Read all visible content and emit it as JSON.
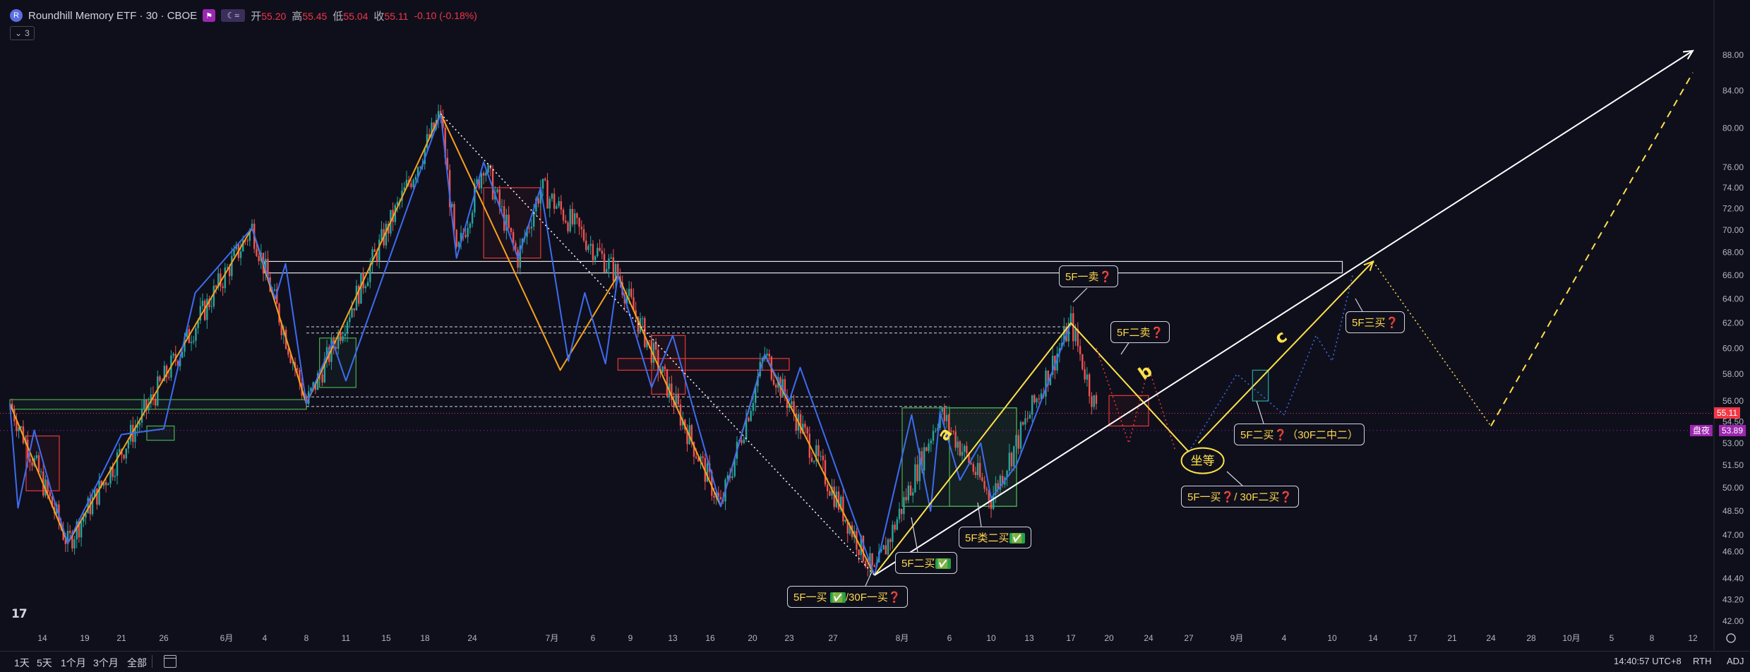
{
  "header": {
    "symbol_title": "Roundhill Memory ETF · 30 · CBOE",
    "logo_letter": "R",
    "open_label": "开",
    "open": "55.20",
    "high_label": "高",
    "high": "55.45",
    "low_label": "低",
    "low": "55.04",
    "close_label": "收",
    "close": "55.11",
    "change": "-0.10 (-0.18%)",
    "indicator_count": "3"
  },
  "bottom_bar": {
    "ranges": [
      "1天",
      "5天",
      "1个月",
      "3个月",
      "全部"
    ],
    "clock": "14:40:57 UTC+8",
    "rth": "RTH",
    "adj": "ADJ"
  },
  "price_tags": {
    "last": "55.11",
    "extended_label": "盘夜",
    "extended": "53.89",
    "last_color": "#f23645",
    "extended_color": "#9c27b0"
  },
  "colors": {
    "background": "#0f0f1c",
    "orange_stroke": "#f7a21b",
    "blue_stroke": "#3d6cf0",
    "yellow": "#ffe24a",
    "bull": "#26a69a",
    "bear": "#ef5350"
  },
  "annotations": {
    "c1": {
      "text": "5F一买",
      "ok": "✅",
      "text2": "/30F一买",
      "q": "❓"
    },
    "c2": {
      "text": "5F二买",
      "ok": "✅"
    },
    "c3": {
      "text": "5F类二买",
      "ok": "✅"
    },
    "c4": {
      "text": "5F一卖",
      "q": "❓"
    },
    "c5": {
      "text": "5F二卖",
      "q": "❓"
    },
    "c6": {
      "text": "5F三买",
      "q": "❓"
    },
    "c7": {
      "text": "5F二买",
      "q": "❓",
      "text2": "（30F二中二）"
    },
    "c8": {
      "text": "5F一买",
      "q": "❓",
      "text2": "/ 30F二买",
      "q2": "❓"
    },
    "circle": "坐等",
    "letter_a": "a",
    "letter_b": "b",
    "letter_c": "c"
  },
  "chart_data": {
    "type": "line",
    "title": "Roundhill Memory ETF · 30 · CBOE",
    "y_axis": {
      "scale": "log",
      "ticks": [
        42.0,
        43.2,
        44.4,
        46.0,
        47.0,
        48.5,
        50.0,
        51.5,
        53.0,
        54.5,
        56.0,
        58.0,
        60.0,
        62.0,
        64.0,
        66.0,
        68.0,
        70.0,
        72.0,
        74.0,
        76.0,
        80.0,
        84.0,
        88.0
      ],
      "range": [
        41.5,
        89.5
      ]
    },
    "x_axis": {
      "ticks": [
        {
          "date": "2025-05-14",
          "label": "14"
        },
        {
          "date": "2025-05-19",
          "label": "19"
        },
        {
          "date": "2025-05-21",
          "label": "21"
        },
        {
          "date": "2025-05-26",
          "label": "26"
        },
        {
          "date": "2025-06-01",
          "label": "6月"
        },
        {
          "date": "2025-06-04",
          "label": "4"
        },
        {
          "date": "2025-06-08",
          "label": "8"
        },
        {
          "date": "2025-06-11",
          "label": "11"
        },
        {
          "date": "2025-06-15",
          "label": "15"
        },
        {
          "date": "2025-06-18",
          "label": "18"
        },
        {
          "date": "2025-06-24",
          "label": "24"
        },
        {
          "date": "2025-07-01",
          "label": "7月"
        },
        {
          "date": "2025-07-06",
          "label": "6"
        },
        {
          "date": "2025-07-09",
          "label": "9"
        },
        {
          "date": "2025-07-13",
          "label": "13"
        },
        {
          "date": "2025-07-16",
          "label": "16"
        },
        {
          "date": "2025-07-20",
          "label": "20"
        },
        {
          "date": "2025-07-23",
          "label": "23"
        },
        {
          "date": "2025-07-27",
          "label": "27"
        },
        {
          "date": "2025-08-01",
          "label": "8月"
        },
        {
          "date": "2025-08-06",
          "label": "6"
        },
        {
          "date": "2025-08-10",
          "label": "10"
        },
        {
          "date": "2025-08-13",
          "label": "13"
        },
        {
          "date": "2025-08-17",
          "label": "17"
        },
        {
          "date": "2025-08-20",
          "label": "20"
        },
        {
          "date": "2025-08-24",
          "label": "24"
        },
        {
          "date": "2025-08-27",
          "label": "27"
        },
        {
          "date": "2025-09-01",
          "label": "9月"
        },
        {
          "date": "2025-09-04",
          "label": "4"
        },
        {
          "date": "2025-09-10",
          "label": "10"
        },
        {
          "date": "2025-09-14",
          "label": "14"
        },
        {
          "date": "2025-09-17",
          "label": "17"
        },
        {
          "date": "2025-09-21",
          "label": "21"
        },
        {
          "date": "2025-09-24",
          "label": "24"
        },
        {
          "date": "2025-09-28",
          "label": "28"
        },
        {
          "date": "2025-10-01",
          "label": "10月"
        },
        {
          "date": "2025-10-05",
          "label": "5"
        },
        {
          "date": "2025-10-08",
          "label": "8"
        },
        {
          "date": "2025-10-12",
          "label": "12"
        }
      ]
    },
    "series": [
      {
        "role": "orange-stroke-lines",
        "points": [
          [
            "2025-05-10",
            55.8
          ],
          [
            "2025-05-17",
            46.5
          ],
          [
            "2025-06-03",
            70.2
          ],
          [
            "2025-06-08",
            55.8
          ],
          [
            "2025-06-20",
            81.5
          ],
          [
            "2025-07-02",
            58.3
          ],
          [
            "2025-07-08",
            66.0
          ],
          [
            "2025-07-17",
            48.8
          ],
          [
            "2025-07-21",
            59.5
          ],
          [
            "2025-07-30",
            44.6
          ]
        ]
      },
      {
        "role": "blue-stroke-lines",
        "points": [
          [
            "2025-05-10",
            55.8
          ],
          [
            "2025-05-11",
            48.7
          ],
          [
            "2025-05-13",
            53.9
          ],
          [
            "2025-05-15",
            49.9
          ],
          [
            "2025-05-17",
            46.5
          ],
          [
            "2025-05-21",
            53.6
          ],
          [
            "2025-05-26",
            54.0
          ],
          [
            "2025-05-29",
            64.5
          ],
          [
            "2025-06-03",
            70.2
          ],
          [
            "2025-06-05",
            64.0
          ],
          [
            "2025-06-06",
            67.0
          ],
          [
            "2025-06-08",
            55.8
          ],
          [
            "2025-06-10",
            60.5
          ],
          [
            "2025-06-11",
            57.5
          ],
          [
            "2025-06-20",
            81.5
          ],
          [
            "2025-06-22",
            67.5
          ],
          [
            "2025-06-25",
            76.5
          ],
          [
            "2025-06-28",
            67.5
          ],
          [
            "2025-06-30",
            74.0
          ],
          [
            "2025-07-03",
            59.0
          ],
          [
            "2025-07-05",
            64.5
          ],
          [
            "2025-07-07",
            58.8
          ],
          [
            "2025-07-08",
            66.0
          ],
          [
            "2025-07-11",
            57.0
          ],
          [
            "2025-07-13",
            61.0
          ],
          [
            "2025-07-17",
            48.8
          ],
          [
            "2025-07-21",
            59.5
          ],
          [
            "2025-07-23",
            56.0
          ],
          [
            "2025-07-24",
            58.5
          ],
          [
            "2025-07-30",
            44.6
          ],
          [
            "2025-08-02",
            55.0
          ],
          [
            "2025-08-04",
            48.5
          ],
          [
            "2025-08-05",
            55.2
          ],
          [
            "2025-08-07",
            50.5
          ],
          [
            "2025-08-09",
            53.0
          ],
          [
            "2025-08-10",
            49.3
          ],
          [
            "2025-08-12",
            51.5
          ],
          [
            "2025-08-17",
            62.0
          ]
        ]
      },
      {
        "role": "yellow-stroke-lines",
        "points": [
          [
            "2025-07-30",
            44.6
          ],
          [
            "2025-08-17",
            62.0
          ],
          [
            "2025-08-27",
            52.4
          ]
        ]
      },
      {
        "role": "yellow-projection",
        "points": [
          [
            "2025-08-28",
            53.0
          ],
          [
            "2025-09-14",
            67.2
          ]
        ]
      },
      {
        "role": "yellow-dotted-projection",
        "points": [
          [
            "2025-09-14",
            67.2
          ],
          [
            "2025-09-24",
            54.2
          ]
        ]
      },
      {
        "role": "yellow-dashed-projection",
        "points": [
          [
            "2025-09-24",
            54.2
          ],
          [
            "2025-10-12",
            86.0
          ]
        ]
      },
      {
        "role": "white-trendline-arrow",
        "points": [
          [
            "2025-07-30",
            44.6
          ],
          [
            "2025-10-12",
            88.5
          ]
        ]
      },
      {
        "role": "white-dotted-trendline",
        "points": [
          [
            "2025-06-20",
            81.5
          ],
          [
            "2025-07-30",
            44.6
          ]
        ]
      },
      {
        "role": "blue-dotted-projection",
        "points": [
          [
            "2025-08-27",
            52.4
          ],
          [
            "2025-09-01",
            58.0
          ],
          [
            "2025-09-04",
            55.0
          ],
          [
            "2025-09-08",
            61.0
          ],
          [
            "2025-09-10",
            59.0
          ],
          [
            "2025-09-12",
            66.0
          ]
        ]
      },
      {
        "role": "red-dotted-projection",
        "points": [
          [
            "2025-08-19",
            60.0
          ],
          [
            "2025-08-22",
            53.0
          ],
          [
            "2025-08-24",
            58.5
          ],
          [
            "2025-08-26",
            52.5
          ]
        ]
      }
    ],
    "candles": {
      "path": [
        [
          "2025-05-10",
          55.8
        ],
        [
          "2025-05-17",
          46.5
        ],
        [
          "2025-06-03",
          70.2
        ],
        [
          "2025-06-08",
          55.8
        ],
        [
          "2025-06-20",
          81.5
        ],
        [
          "2025-06-22",
          67.5
        ],
        [
          "2025-06-25",
          76.5
        ],
        [
          "2025-06-28",
          67.5
        ],
        [
          "2025-06-30",
          74.0
        ],
        [
          "2025-07-08",
          66.0
        ],
        [
          "2025-07-17",
          48.8
        ],
        [
          "2025-07-21",
          59.5
        ],
        [
          "2025-07-30",
          44.6
        ],
        [
          "2025-08-05",
          55.2
        ],
        [
          "2025-08-10",
          49.3
        ],
        [
          "2025-08-17",
          62.0
        ],
        [
          "2025-08-19",
          55.3
        ]
      ]
    },
    "zones": [
      {
        "color": "white",
        "x": [
          "2025-06-04",
          "2025-09-11"
        ],
        "y": [
          66.2,
          67.2
        ]
      },
      {
        "color": "green",
        "x": [
          "2025-05-10",
          "2025-06-08"
        ],
        "y": [
          55.4,
          56.1
        ]
      },
      {
        "color": "red",
        "x": [
          "2025-05-12",
          "2025-05-16"
        ],
        "y": [
          49.8,
          53.5
        ]
      },
      {
        "color": "green",
        "x": [
          "2025-05-24",
          "2025-05-27"
        ],
        "y": [
          53.2,
          54.2
        ]
      },
      {
        "color": "green",
        "x": [
          "2025-06-09",
          "2025-06-12"
        ],
        "y": [
          57.0,
          60.8
        ]
      },
      {
        "color": "red",
        "x": [
          "2025-06-25",
          "2025-06-30"
        ],
        "y": [
          67.5,
          74.0
        ]
      },
      {
        "color": "red",
        "x": [
          "2025-07-08",
          "2025-07-23"
        ],
        "y": [
          58.3,
          59.2
        ]
      },
      {
        "color": "red",
        "x": [
          "2025-07-11",
          "2025-07-14"
        ],
        "y": [
          56.5,
          61.0
        ]
      },
      {
        "color": "green",
        "x": [
          "2025-08-01",
          "2025-08-12"
        ],
        "y": [
          48.8,
          55.5
        ]
      },
      {
        "color": "green",
        "x": [
          "2025-08-06",
          "2025-08-12"
        ],
        "y": [
          48.8,
          55.5
        ]
      },
      {
        "color": "red",
        "x": [
          "2025-08-20",
          "2025-08-24"
        ],
        "y": [
          54.2,
          56.4
        ]
      },
      {
        "color": "cyan",
        "x": [
          "2025-09-02",
          "2025-09-03"
        ],
        "y": [
          56.0,
          58.3
        ]
      }
    ],
    "horizontal_dashed": [
      {
        "y": 61.7,
        "x": [
          "2025-06-08",
          "2025-08-17"
        ]
      },
      {
        "y": 61.2,
        "x": [
          "2025-06-08",
          "2025-08-17"
        ]
      },
      {
        "y": 56.3,
        "x": [
          "2025-06-08",
          "2025-08-06"
        ]
      },
      {
        "y": 55.6,
        "x": [
          "2025-06-08",
          "2025-08-06"
        ]
      }
    ],
    "last_price": 55.11,
    "extended_price": 53.89,
    "grid": false,
    "legend": "none"
  }
}
